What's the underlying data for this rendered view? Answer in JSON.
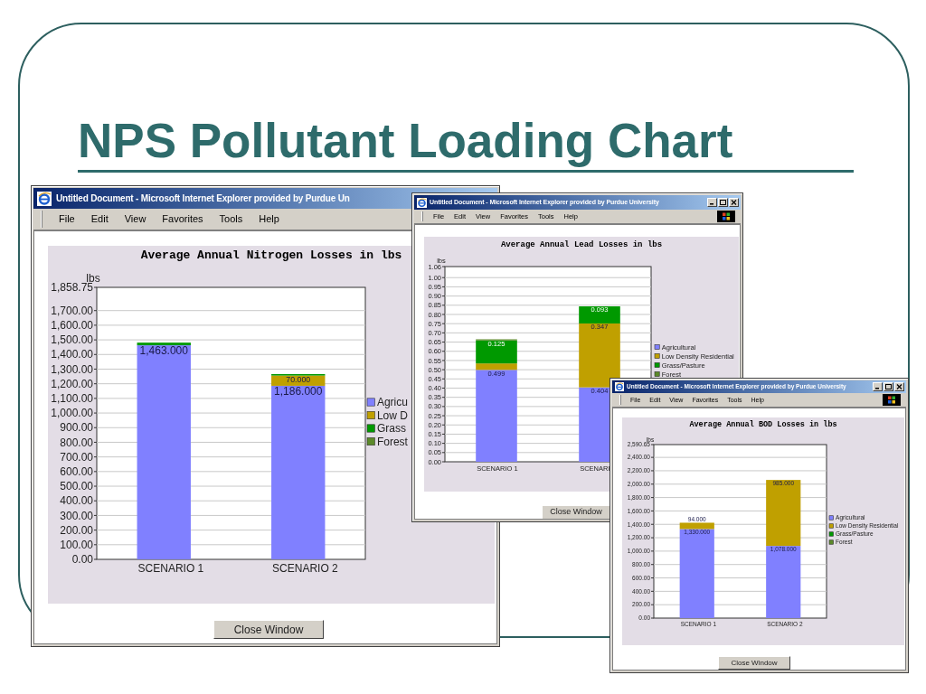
{
  "slide": {
    "title": "NPS Pollutant Loading Chart"
  },
  "windows": [
    {
      "title": "Untitled Document - Microsoft Internet Explorer provided by Purdue Un",
      "menu": [
        "File",
        "Edit",
        "View",
        "Favorites",
        "Tools",
        "Help"
      ],
      "chart_data": {
        "type": "bar",
        "stacked": true,
        "title": "Average Annual Nitrogen Losses in lbs",
        "grid": true,
        "legend": true,
        "ylabel": "lbs",
        "categories": [
          "SCENARIO 1",
          "SCENARIO 2"
        ],
        "ylim": [
          0,
          1858.75
        ],
        "yticks": [
          {
            "value": 0,
            "label": "0.00"
          },
          {
            "value": 100,
            "label": "100.00"
          },
          {
            "value": 200,
            "label": "200.00"
          },
          {
            "value": 300,
            "label": "300.00"
          },
          {
            "value": 400,
            "label": "400.00"
          },
          {
            "value": 500,
            "label": "500.00"
          },
          {
            "value": 600,
            "label": "600.00"
          },
          {
            "value": 700,
            "label": "700.00"
          },
          {
            "value": 800,
            "label": "800.00"
          },
          {
            "value": 900,
            "label": "900.00"
          },
          {
            "value": 1000,
            "label": "1,000.00"
          },
          {
            "value": 1100,
            "label": "1,100.00"
          },
          {
            "value": 1200,
            "label": "1,200.00"
          },
          {
            "value": 1300,
            "label": "1,300.00"
          },
          {
            "value": 1400,
            "label": "1,400.00"
          },
          {
            "value": 1500,
            "label": "1,500.00"
          },
          {
            "value": 1600,
            "label": "1,600.00"
          },
          {
            "value": 1700,
            "label": "1,700.00"
          },
          {
            "value": 1858.75,
            "label": "1,858.75"
          }
        ],
        "series": [
          {
            "name": "Agricu",
            "color": "#8080ff",
            "values": [
              1463,
              1186
            ],
            "value_labels": [
              "1,463.000",
              "1,186.000"
            ]
          },
          {
            "name": "Low D",
            "color": "#c0a000",
            "values": [
              0,
              70
            ],
            "value_labels": [
              null,
              "70.000"
            ]
          },
          {
            "name": "Grass",
            "color": "#009900",
            "values": [
              18,
              10
            ]
          },
          {
            "name": "Forest",
            "color": "#5c8a2a",
            "values": [
              0,
              0
            ]
          }
        ]
      },
      "button": "Close Window"
    },
    {
      "title": "Untitled Document - Microsoft Internet Explorer provided by Purdue University",
      "menu": [
        "File",
        "Edit",
        "View",
        "Favorites",
        "Tools",
        "Help"
      ],
      "chart_data": {
        "type": "bar",
        "stacked": true,
        "title": "Average Annual Lead Losses in lbs",
        "grid": true,
        "legend": true,
        "ylabel": "lbs",
        "categories": [
          "SCENARIO 1",
          "SCENARI"
        ],
        "ylim": [
          0,
          1.06
        ],
        "yticks": [
          {
            "value": 0,
            "label": "0.00"
          },
          {
            "value": 0.05,
            "label": "0.05"
          },
          {
            "value": 0.1,
            "label": "0.10"
          },
          {
            "value": 0.15,
            "label": "0.15"
          },
          {
            "value": 0.2,
            "label": "0.20"
          },
          {
            "value": 0.25,
            "label": "0.25"
          },
          {
            "value": 0.3,
            "label": "0.30"
          },
          {
            "value": 0.35,
            "label": "0.35"
          },
          {
            "value": 0.4,
            "label": "0.40"
          },
          {
            "value": 0.45,
            "label": "0.45"
          },
          {
            "value": 0.5,
            "label": "0.50"
          },
          {
            "value": 0.55,
            "label": "0.55"
          },
          {
            "value": 0.6,
            "label": "0.60"
          },
          {
            "value": 0.65,
            "label": "0.65"
          },
          {
            "value": 0.7,
            "label": "0.70"
          },
          {
            "value": 0.75,
            "label": "0.75"
          },
          {
            "value": 0.8,
            "label": "0.80"
          },
          {
            "value": 0.85,
            "label": "0.85"
          },
          {
            "value": 0.9,
            "label": "0.90"
          },
          {
            "value": 0.95,
            "label": "0.95"
          },
          {
            "value": 1,
            "label": "1.00"
          },
          {
            "value": 1.06,
            "label": "1.06"
          }
        ],
        "series": [
          {
            "name": "Agricultural",
            "color": "#8080ff",
            "values": [
              0.499,
              0.404
            ],
            "value_labels": [
              "0.499",
              "0.404"
            ]
          },
          {
            "name": "Low Density Residential",
            "color": "#c0a000",
            "values": [
              0.035,
              0.347
            ],
            "value_labels": [
              null,
              "0.347"
            ]
          },
          {
            "name": "Grass/Pasture",
            "color": "#009900",
            "values": [
              0.125,
              0.093
            ],
            "value_labels": [
              "0.125",
              "0.093"
            ]
          },
          {
            "name": "Forest",
            "color": "#5c8a2a",
            "values": [
              0.006,
              0
            ]
          }
        ]
      },
      "button": "Close Window"
    },
    {
      "title": "Untitled Document - Microsoft Internet Explorer provided by Purdue University",
      "menu": [
        "File",
        "Edit",
        "View",
        "Favorites",
        "Tools",
        "Help"
      ],
      "chart_data": {
        "type": "bar",
        "stacked": true,
        "title": "Average Annual BOD Losses in lbs",
        "grid": true,
        "legend": true,
        "ylabel": "lbs",
        "categories": [
          "SCENARIO 1",
          "SCENARIO 2"
        ],
        "ylim": [
          0,
          2590.65
        ],
        "yticks": [
          {
            "value": 0,
            "label": "0.00"
          },
          {
            "value": 200,
            "label": "200.00"
          },
          {
            "value": 400,
            "label": "400.00"
          },
          {
            "value": 600,
            "label": "600.00"
          },
          {
            "value": 800,
            "label": "800.00"
          },
          {
            "value": 1000,
            "label": "1,000.00"
          },
          {
            "value": 1200,
            "label": "1,200.00"
          },
          {
            "value": 1400,
            "label": "1,400.00"
          },
          {
            "value": 1600,
            "label": "1,600.00"
          },
          {
            "value": 1800,
            "label": "1,800.00"
          },
          {
            "value": 2000,
            "label": "2,000.00"
          },
          {
            "value": 2200,
            "label": "2,200.00"
          },
          {
            "value": 2400,
            "label": "2,400.00"
          },
          {
            "value": 2590.65,
            "label": "2,590.65"
          }
        ],
        "series": [
          {
            "name": "Agricultural",
            "color": "#8080ff",
            "values": [
              1330,
              1078
            ],
            "value_labels": [
              "1,330.000",
              "1,078.000"
            ]
          },
          {
            "name": "Low Density Residential",
            "color": "#c0a000",
            "values": [
              94,
              985
            ],
            "value_labels": [
              "94.000",
              "985.000"
            ]
          },
          {
            "name": "Grass/Pasture",
            "color": "#009900",
            "values": [
              0,
              0
            ]
          },
          {
            "name": "Forest",
            "color": "#5c8a2a",
            "values": [
              0,
              0
            ]
          }
        ]
      },
      "button": "Close Window"
    }
  ]
}
